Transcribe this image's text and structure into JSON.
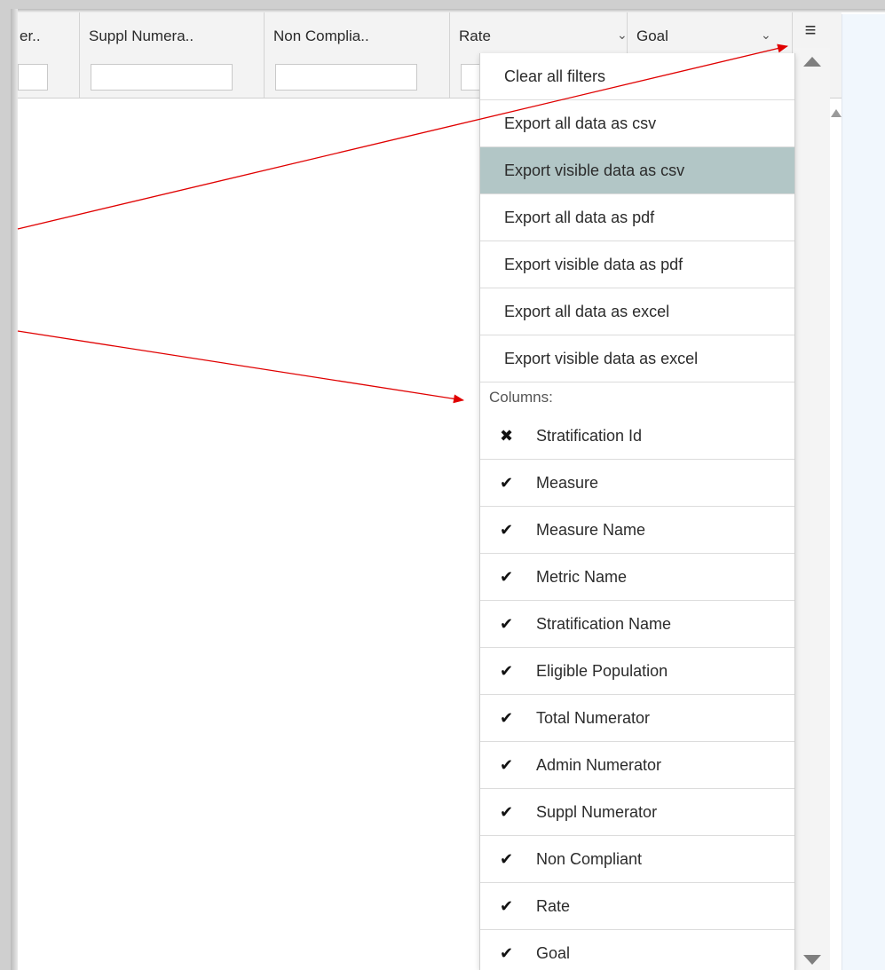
{
  "grid": {
    "columns": [
      {
        "title": "er..",
        "chevron": "⌄"
      },
      {
        "title": "Suppl Numera..",
        "chevron": "⌄"
      },
      {
        "title": "Non Complia..",
        "chevron": "⌄"
      },
      {
        "title": "Rate",
        "chevron": "⌄"
      },
      {
        "title": "Goal",
        "chevron": "⌄"
      }
    ],
    "menu_icon": "hamburger-icon",
    "menu_glyph": "≡"
  },
  "menu": {
    "actions": [
      {
        "label": "Clear all filters"
      },
      {
        "label": "Export all data as csv"
      },
      {
        "label": "Export visible data as csv"
      },
      {
        "label": "Export all data as pdf"
      },
      {
        "label": "Export visible data as pdf"
      },
      {
        "label": "Export all data as excel"
      },
      {
        "label": "Export visible data as excel"
      }
    ],
    "highlighted_action": "Export visible data as csv",
    "highlight_color": "#b2c6c6",
    "columns_heading": "Columns:",
    "columns": [
      {
        "label": "Stratification Id",
        "visible": false,
        "mark": "✖"
      },
      {
        "label": "Measure",
        "visible": true,
        "mark": "✔"
      },
      {
        "label": "Measure Name",
        "visible": true,
        "mark": "✔"
      },
      {
        "label": "Metric Name",
        "visible": true,
        "mark": "✔"
      },
      {
        "label": "Stratification Name",
        "visible": true,
        "mark": "✔"
      },
      {
        "label": "Eligible Population",
        "visible": true,
        "mark": "✔"
      },
      {
        "label": "Total Numerator",
        "visible": true,
        "mark": "✔"
      },
      {
        "label": "Admin Numerator",
        "visible": true,
        "mark": "✔"
      },
      {
        "label": "Suppl Numerator",
        "visible": true,
        "mark": "✔"
      },
      {
        "label": "Non Compliant",
        "visible": true,
        "mark": "✔"
      },
      {
        "label": "Rate",
        "visible": true,
        "mark": "✔"
      },
      {
        "label": "Goal",
        "visible": true,
        "mark": "✔"
      }
    ]
  },
  "annotation": {
    "arrow_color": "#e00000"
  }
}
